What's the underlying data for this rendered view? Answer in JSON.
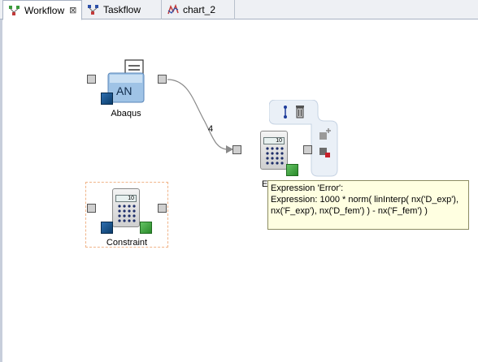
{
  "tabs": [
    {
      "label": "Workflow",
      "close": "⊠",
      "active": true
    },
    {
      "label": "Taskflow",
      "active": false
    },
    {
      "label": "chart_2",
      "active": false
    }
  ],
  "nodes": {
    "abaqus": {
      "label": "Abaqus",
      "icon_text": "AN"
    },
    "constraint": {
      "label": "Constraint",
      "screen": "10"
    },
    "error": {
      "label": "E",
      "screen": "10"
    }
  },
  "connection": {
    "label": "4"
  },
  "tooltip": {
    "line1": "Expression 'Error':",
    "line2": "Expression: 1000 * norm(  linInterp( nx('D_exp'),",
    "line3": " nx('F_exp'), nx('D_fem') ) - nx('F_fem') )"
  },
  "colors": {
    "tooltip_bg": "#ffffe1",
    "port": "#cfcfcf",
    "selection_border": "#f0b489"
  }
}
